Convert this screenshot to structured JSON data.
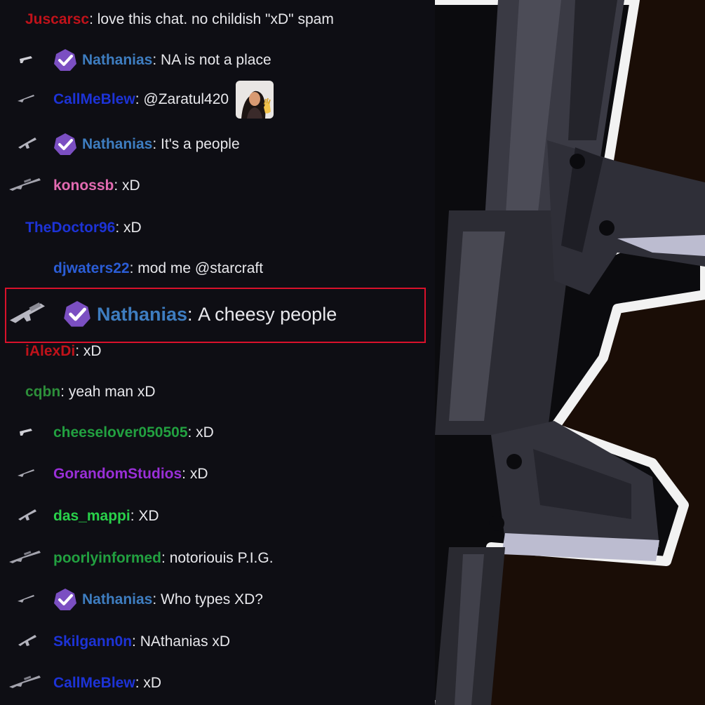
{
  "colors": {
    "chat_bg": "#0e0e14",
    "background": "#1a0d06",
    "highlight_border": "#d9112b",
    "moderator_badge": "#7b4fc2"
  },
  "chat": {
    "messages": [
      {
        "user": "Juscarsc",
        "user_color": "#c0121a",
        "separator": ": ",
        "text": "love this chat. no childish \"xD\" spam",
        "badge": false,
        "gun_icon": "none"
      },
      {
        "user": "Nathanias",
        "user_color": "#3e7dc0",
        "separator": ": ",
        "text": "NA is not a place",
        "badge": true,
        "gun_icon": "pistol-icon"
      },
      {
        "user": "CallMeBlew",
        "user_color": "#1d33d6",
        "separator": ": ",
        "text": "@Zaratul420",
        "badge": false,
        "gun_icon": "rifle-icon",
        "emote": "waving-woman-emote"
      },
      {
        "user": "Nathanias",
        "user_color": "#3e7dc0",
        "separator": ": ",
        "text": "It's a people",
        "badge": true,
        "gun_icon": "smg-icon"
      },
      {
        "user": "konossb",
        "user_color": "#e36bb2",
        "separator": ": ",
        "text": "xD",
        "badge": false,
        "gun_icon": "sniper-icon"
      },
      {
        "user": "TheDoctor96",
        "user_color": "#1d33d6",
        "separator": ": ",
        "text": "xD",
        "badge": false,
        "gun_icon": "none"
      },
      {
        "user": "djwaters22",
        "user_color": "#2b5dd6",
        "separator": ": ",
        "text": "mod me @starcraft",
        "badge": false,
        "gun_icon": "none"
      },
      {
        "user": "Nathanias",
        "user_color": "#3e7dc0",
        "separator": ": ",
        "text": "A cheesy people",
        "badge": true,
        "gun_icon": "launcher-icon",
        "highlighted": true
      },
      {
        "user": "iAlexDi",
        "user_color": "#c0121a",
        "separator": ": ",
        "text": "xD",
        "badge": false,
        "gun_icon": "none"
      },
      {
        "user": "cqbn",
        "user_color": "#2d8f3a",
        "separator": ": ",
        "text": "yeah man xD",
        "badge": false,
        "gun_icon": "none"
      },
      {
        "user": "cheeselover050505",
        "user_color": "#22a040",
        "separator": ": ",
        "text": "xD",
        "badge": false,
        "gun_icon": "pistol-icon"
      },
      {
        "user": "GorandomStudios",
        "user_color": "#9a2fd8",
        "separator": ": ",
        "text": "xD",
        "badge": false,
        "gun_icon": "rifle-icon"
      },
      {
        "user": "das_mappi",
        "user_color": "#29d14a",
        "separator": ": ",
        "text": "XD",
        "badge": false,
        "gun_icon": "smg-icon"
      },
      {
        "user": "poorlyinformed",
        "user_color": "#22a040",
        "separator": ": ",
        "text": "notoriouis P.I.G.",
        "badge": false,
        "gun_icon": "sniper-icon"
      },
      {
        "user": "Nathanias",
        "user_color": "#3e7dc0",
        "separator": ": ",
        "text": "Who types XD?",
        "badge": true,
        "gun_icon": "rifle-icon"
      },
      {
        "user": "Skilgann0n",
        "user_color": "#1d33d6",
        "separator": ": ",
        "text": "NAthanias xD",
        "badge": false,
        "gun_icon": "smg-icon"
      },
      {
        "user": "CallMeBlew",
        "user_color": "#1d33d6",
        "separator": ": ",
        "text": "xD",
        "badge": false,
        "gun_icon": "sniper-icon"
      }
    ]
  }
}
